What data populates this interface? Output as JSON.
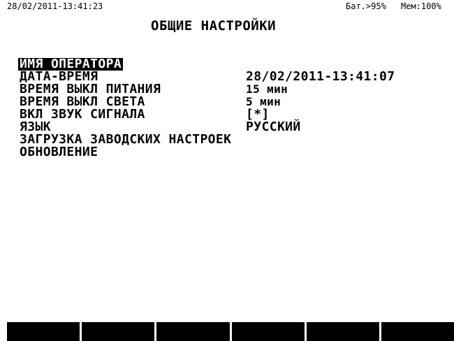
{
  "status": {
    "datetime": "28/02/2011-13:41:23",
    "battery": "Бат.>95%",
    "memory": "Мем:100%"
  },
  "title": "ОБЩИЕ НАСТРОЙКИ",
  "menu": [
    {
      "label": "ИМЯ ОПЕРАТОРА",
      "value": "",
      "selected": true
    },
    {
      "label": "ДАТА-ВРЕМЯ",
      "value": "28/02/2011-13:41:07",
      "selected": false
    },
    {
      "label": "ВРЕМЯ ВЫКЛ ПИТАНИЯ",
      "value": "15 мин",
      "selected": false
    },
    {
      "label": "ВРЕМЯ ВЫКЛ СВЕТА",
      "value": "5 мин",
      "selected": false
    },
    {
      "label": "ВКЛ ЗВУК СИГНАЛА",
      "value": "[*]",
      "selected": false
    },
    {
      "label": "ЯЗЫК",
      "value": "РУССКИЙ",
      "selected": false
    },
    {
      "label": "ЗАГРУЗКА ЗАВОДСКИХ НАСТРОЕК",
      "value": "",
      "selected": false
    },
    {
      "label": "ОБНОВЛЕНИЕ",
      "value": "",
      "selected": false
    }
  ],
  "softkeys": [
    "",
    "",
    "",
    "",
    "",
    ""
  ]
}
